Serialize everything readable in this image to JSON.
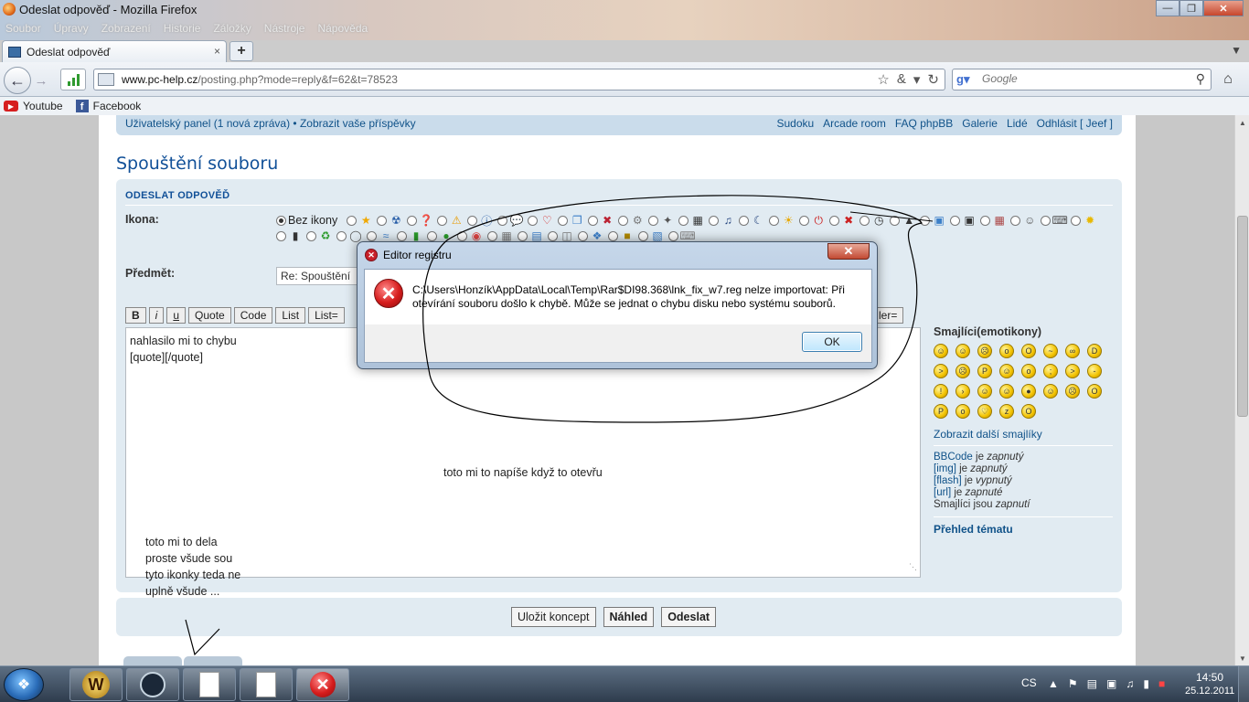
{
  "window": {
    "title": "Odeslat odpověď - Mozilla Firefox",
    "menu": [
      "Soubor",
      "Úpravy",
      "Zobrazení",
      "Historie",
      "Záložky",
      "Nástroje",
      "Nápověda"
    ]
  },
  "tab": {
    "label": "Odeslat odpověď",
    "close": "×"
  },
  "nav": {
    "url_domain": "www.pc-help.cz",
    "url_path": "/posting.php?mode=reply&f=62&t=78523",
    "search_placeholder": "Google"
  },
  "bookmarks": [
    {
      "label": "Youtube",
      "icon": "youtube-icon"
    },
    {
      "label": "Facebook",
      "icon": "facebook-icon"
    }
  ],
  "forum": {
    "user_panel": "Uživatelský panel (1 nová zpráva) • Zobrazit vaše příspěvky",
    "top_links": [
      "Sudoku",
      "Arcade room",
      "FAQ phpBB",
      "Galerie",
      "Lidé",
      "Odhlásit [ Jeef ]"
    ],
    "page_title": "Spouštění souboru",
    "panel_title": "ODESLAT ODPOVĚĎ",
    "icon_label": "Ikona:",
    "icon_none": "Bez ikony",
    "subject_label": "Předmět:",
    "subject_value": "Re: Spouštění",
    "bbcode_buttons": [
      "B",
      "i",
      "u",
      "Quote",
      "Code",
      "List",
      "List="
    ],
    "bbcode_right": "ler=",
    "message_lines": [
      "nahlasilo mi to chybu",
      "[quote][/quote]"
    ],
    "annotation_main": "toto mi to napíše když to otevřu",
    "annotation_lines": [
      "toto mi to dela",
      "proste všude sou",
      "tyto ikonky teda ne",
      "uplně všude ..."
    ],
    "smilies_title": "Smajlíci(emotikony)",
    "more_smilies": "Zobrazit další smajlíky",
    "bbinfo": [
      {
        "name": "BBCode",
        "state": "zapnutý"
      },
      {
        "name": "[img]",
        "state": "zapnutý"
      },
      {
        "name": "[flash]",
        "state": "vypnutý"
      },
      {
        "name": "[url]",
        "state": "zapnuté"
      },
      {
        "name": "Smajlíci",
        "state": "zapnutí"
      }
    ],
    "bbinfo_verbs": [
      "je",
      "je",
      "je",
      "je",
      "jsou"
    ],
    "topic_review": "Přehled tématu",
    "actions": [
      "Uložit koncept",
      "Náhled",
      "Odeslat"
    ]
  },
  "dialog": {
    "title": "Editor registru",
    "message": "C:\\Users\\Honzík\\AppData\\Local\\Temp\\Rar$DI98.368\\lnk_fix_w7.reg nelze importovat: Při otevírání souboru došlo k chybě. Může se jednat o chybu disku nebo systému souborů.",
    "ok": "OK"
  },
  "taskbar": {
    "language": "CS",
    "time": "14:50",
    "date": "25.12.2011"
  }
}
